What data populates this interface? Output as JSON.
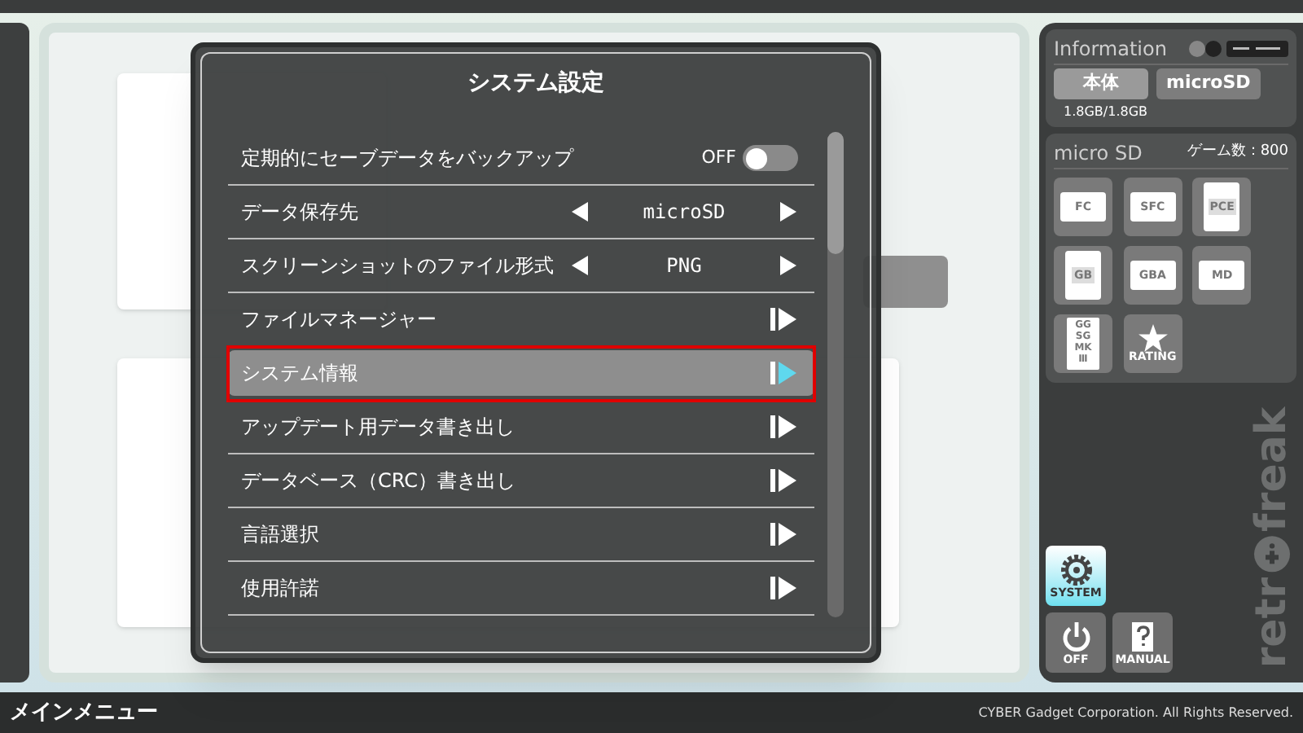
{
  "dialog": {
    "title": "システム設定",
    "items": [
      {
        "kind": "toggle",
        "label": "定期的にセーブデータをバックアップ",
        "value": "OFF",
        "on": false,
        "selected": false
      },
      {
        "kind": "select",
        "label": "データ保存先",
        "value": "microSD",
        "selected": false
      },
      {
        "kind": "select",
        "label": "スクリーンショットのファイル形式",
        "value": "PNG",
        "selected": false
      },
      {
        "kind": "link",
        "label": "ファイルマネージャー",
        "selected": false
      },
      {
        "kind": "link",
        "label": "システム情報",
        "selected": true
      },
      {
        "kind": "link",
        "label": "アップデート用データ書き出し",
        "selected": false
      },
      {
        "kind": "link",
        "label": "データベース（CRC）書き出し",
        "selected": false
      },
      {
        "kind": "link",
        "label": "言語選択",
        "selected": false
      },
      {
        "kind": "link",
        "label": "使用許諾",
        "selected": false
      }
    ]
  },
  "info": {
    "title": "Information",
    "tabs": [
      {
        "label": "本体",
        "selected": true
      },
      {
        "label": "microSD",
        "selected": false
      }
    ],
    "storage": "1.8GB/1.8GB"
  },
  "library": {
    "title": "micro SD",
    "count": "ゲーム数：800",
    "tiles": [
      {
        "kind": "cart",
        "label": "FC"
      },
      {
        "kind": "cart",
        "label": "SFC"
      },
      {
        "kind": "card",
        "label": "PCE"
      },
      {
        "kind": "handheld",
        "label": "GB"
      },
      {
        "kind": "cart",
        "label": "GBA"
      },
      {
        "kind": "cart",
        "label": "MD"
      },
      {
        "kind": "stack",
        "label": "GG SG MKⅢ"
      },
      {
        "kind": "rating",
        "label": "RATING"
      }
    ]
  },
  "logo": {
    "left": "retr",
    "right": "freak"
  },
  "system_buttons": [
    {
      "kind": "gear",
      "label": "SYSTEM",
      "selected": true
    },
    {
      "kind": "power",
      "label": "OFF",
      "selected": false
    },
    {
      "kind": "manual",
      "label": "MANUAL",
      "selected": false
    }
  ],
  "footer": {
    "title": "メインメニュー",
    "copyright": "CYBER Gadget Corporation. All Rights Reserved."
  }
}
